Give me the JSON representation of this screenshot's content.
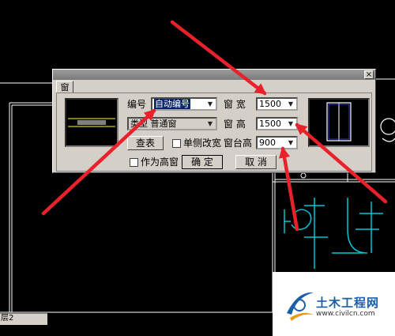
{
  "dialog": {
    "title": "",
    "close_label": "×",
    "tab_label": "窗"
  },
  "fields": {
    "bianhao_label": "编号",
    "bianhao_value": "自动编号",
    "leixing_label": "类型",
    "leixing_value": "普通窗",
    "chuang_kuan_label": "窗  宽",
    "chuang_kuan_value": "1500",
    "chuang_gao_label": "窗  高",
    "chuang_gao_value": "1500",
    "chuangtai_gao_label": "窗台高",
    "chuangtai_gao_value": "900"
  },
  "buttons": {
    "chabiao": "查表",
    "queding": "确  定",
    "quxiao": "取  消"
  },
  "checkboxes": {
    "danze_gaikuan": "单侧改宽",
    "zuowei_gaochuang": "作为高窗"
  },
  "tabs": {
    "bottom_tab": "层2"
  },
  "watermark": {
    "name": "土木工程网",
    "url": "www.civilcn.com"
  },
  "colors": {
    "arrow": "#e8212b",
    "cad_line": "#ffffff",
    "cad_cyan": "#00c8d4",
    "cad_yellow": "#ffff00",
    "title_gray": "#8a8a8a"
  },
  "icons": {
    "dropdown": "chevron-down-icon",
    "close": "close-icon",
    "logo": "civilcn-logo-icon"
  }
}
